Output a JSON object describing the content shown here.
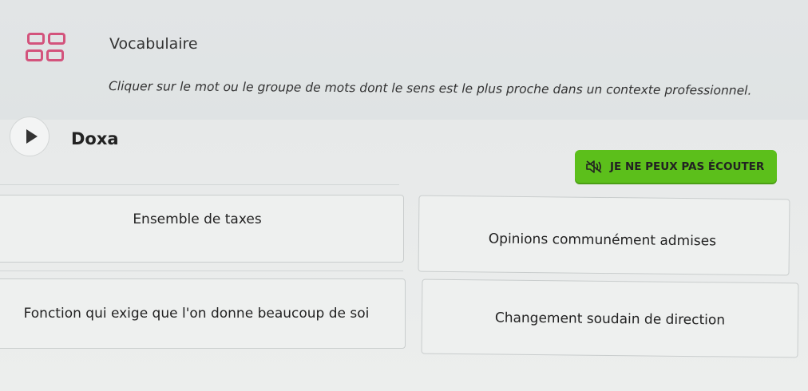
{
  "header": {
    "icon": "exercise-grid-icon",
    "title": "Vocabulaire",
    "instructions": "Cliquer sur le mot ou le groupe de mots dont le sens est le plus proche dans un contexte professionnel."
  },
  "question": {
    "play_icon": "play-icon",
    "word": "Doxa",
    "cant_listen_label": "JE NE PEUX PAS ÉCOUTER",
    "cant_listen_icon": "speaker-muted-icon"
  },
  "choices": [
    {
      "label": "Ensemble de taxes"
    },
    {
      "label": "Opinions communément admises"
    },
    {
      "label": "Fonction qui exige que l'on donne beaucoup de soi"
    },
    {
      "label": "Changement soudain de direction"
    }
  ],
  "colors": {
    "accent_green": "#5cbf1b",
    "icon_pink": "#d3537c"
  }
}
